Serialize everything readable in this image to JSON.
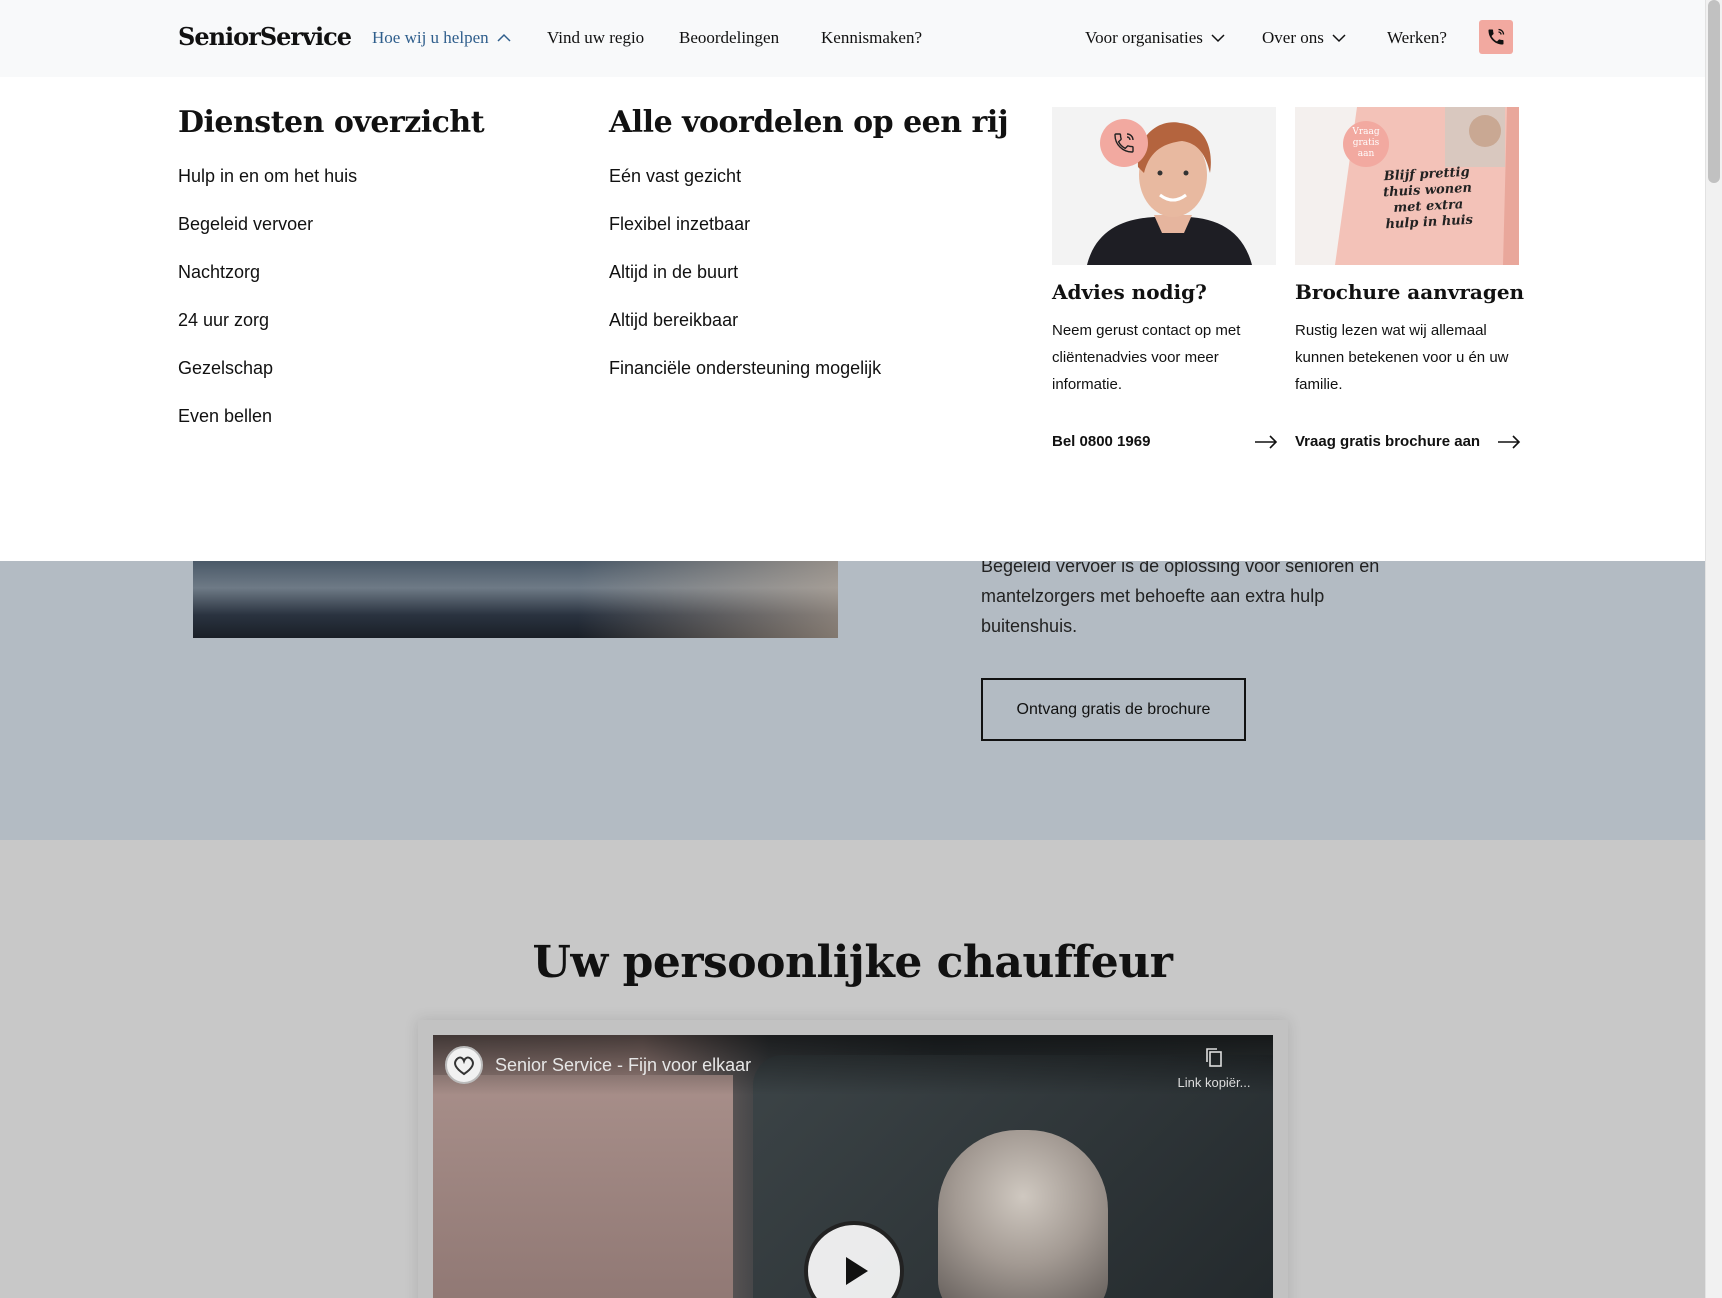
{
  "header": {
    "logo": "SeniorService",
    "nav": [
      {
        "label": "Hoe wij u helpen"
      },
      {
        "label": "Vind uw regio"
      },
      {
        "label": "Beoordelingen"
      },
      {
        "label": "Kennismaken?"
      }
    ],
    "nav_right": [
      {
        "label": "Voor organisaties"
      },
      {
        "label": "Over ons"
      },
      {
        "label": "Werken?"
      }
    ],
    "phone_icon": "phone-icon",
    "colors": {
      "accent_active": "#2f5e8c",
      "phone_bg": "#f2a9a0"
    }
  },
  "megamenu": {
    "services": {
      "title": "Diensten overzicht",
      "items": [
        "Hulp in en om het huis",
        "Begeleid vervoer",
        "Nachtzorg",
        "24 uur zorg",
        "Gezelschap",
        "Even bellen"
      ]
    },
    "benefits": {
      "title": "Alle voordelen op een rij",
      "items": [
        "Eén vast gezicht",
        "Flexibel inzetbaar",
        "Altijd in de buurt",
        "Altijd bereikbaar",
        "Financiële ondersteuning mogelijk"
      ]
    },
    "cards": [
      {
        "title": "Advies nodig?",
        "text": "Neem gerust contact op met cliëntenadvies voor meer informatie.",
        "link": "Bel 0800 1969"
      },
      {
        "title": "Brochure aanvragen",
        "text": "Rustig lezen wat wij allemaal kunnen betekenen voor u én uw familie.",
        "link": "Vraag gratis brochure aan",
        "brochure_badge": [
          "Vraag",
          "gratis",
          "aan"
        ],
        "brochure_cover": [
          "Blijf prettig",
          "thuis wonen",
          "met extra",
          "hulp in huis"
        ]
      }
    ]
  },
  "hero": {
    "text_partial": "Begeleid vervoer is de oplossing voor senioren en mantelzorgers met behoefte aan extra hulp buitenshuis.",
    "button": "Ontvang gratis de brochure"
  },
  "section": {
    "title": "Uw persoonlijke chauffeur",
    "video": {
      "title": "Senior Service - Fijn voor elkaar",
      "copy_link": "Link kopiër..."
    }
  }
}
